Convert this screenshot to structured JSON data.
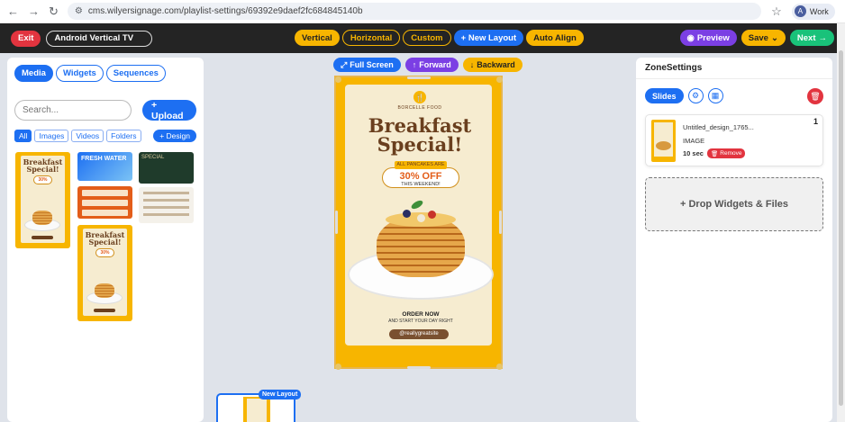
{
  "browser": {
    "url": "cms.wilyersignage.com/playlist-settings/69392e9daef2fc684845140b",
    "profile_initial": "A",
    "profile_name": "Work"
  },
  "header": {
    "exit_label": "Exit",
    "layout_name": "Android Vertical TV",
    "tabs": [
      "Vertical",
      "Horizontal",
      "Custom"
    ],
    "new_layout_label": "+ New Layout",
    "auto_align_label": "Auto Align",
    "preview_label": "Preview",
    "save_label": "Save",
    "next_label": "Next"
  },
  "left_panel": {
    "tabs": [
      "Media",
      "Widgets",
      "Sequences"
    ],
    "search_placeholder": "Search...",
    "upload_label": "+ Upload",
    "filters": [
      "All",
      "Images",
      "Videos",
      "Folders"
    ],
    "design_label": "+ Design",
    "thumbs": {
      "poster_title": "Breakfast Special!",
      "water_title": "FRESH WATER",
      "cafe_title": "SPECIAL"
    }
  },
  "stage": {
    "fullscreen_label": "Full Screen",
    "forward_label": "Forward",
    "backward_label": "Backward",
    "brand": "BORCELLE FOOD",
    "headline": "Breakfast Special!",
    "offer_top": "ALL PANCAKES ARE",
    "offer_big": "30% OFF",
    "offer_small": "THIS WEEKEND!",
    "order_now": "ORDER NOW",
    "order_sub": "AND START YOUR DAY RIGHT",
    "site": "@reallygreatsite",
    "new_layout_tag": "New Layout"
  },
  "right_panel": {
    "title": "ZoneSettings",
    "slides_label": "Slides",
    "slide": {
      "number": "1",
      "name": "Untitled_design_1765...",
      "type": "IMAGE",
      "duration": "10 sec",
      "remove_label": "Remove"
    },
    "dropzone_label": "+ Drop Widgets & Files"
  },
  "colors": {
    "accent_blue": "#1d6ff2",
    "accent_yellow": "#f7b500",
    "danger_red": "#e2343f",
    "purple": "#7b3fe4",
    "green": "#19c27a"
  }
}
